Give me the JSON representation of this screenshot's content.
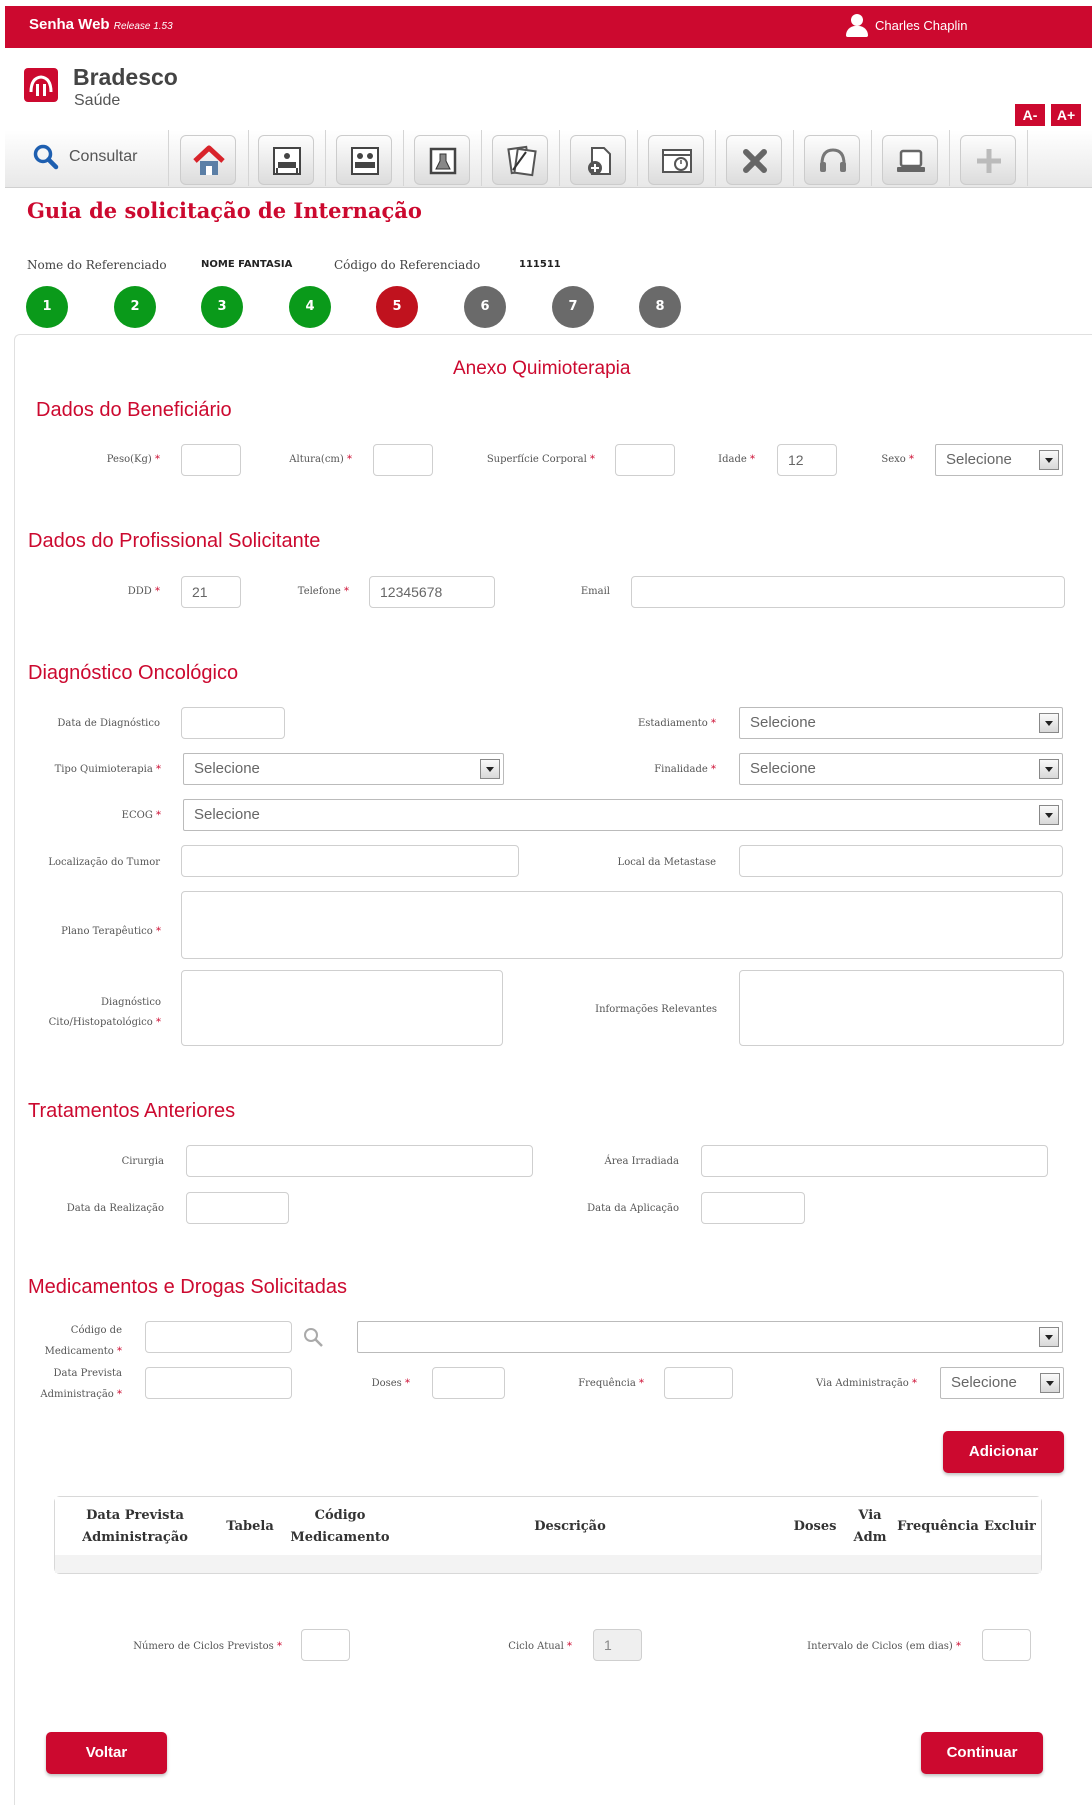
{
  "topbar": {
    "app_name": "Senha Web",
    "release": "Release 1.53",
    "user_name": "Charles Chaplin"
  },
  "logo": {
    "name": "Bradesco",
    "sub": "Saúde"
  },
  "font_controls": {
    "decrease": "A-",
    "increase": "A+"
  },
  "toolbar": {
    "search_label": "Consultar",
    "icons": [
      "home-icon",
      "bed-icon",
      "double-bed-icon",
      "lab-icon",
      "documents-icon",
      "add-file-icon",
      "schedule-icon",
      "close-icon",
      "headset-icon",
      "laptop-icon",
      "plus-icon"
    ]
  },
  "page_title": "Guia de solicitação de Internação",
  "referenced": {
    "name_label": "Nome do Referenciado",
    "name_value": "NOME FANTASIA",
    "code_label": "Código do Referenciado",
    "code_value": "111511"
  },
  "steps": [
    {
      "label": "1",
      "status": "done"
    },
    {
      "label": "2",
      "status": "done"
    },
    {
      "label": "3",
      "status": "done"
    },
    {
      "label": "4",
      "status": "done"
    },
    {
      "label": "5",
      "status": "current"
    },
    {
      "label": "6",
      "status": "pending"
    },
    {
      "label": "7",
      "status": "pending"
    },
    {
      "label": "8",
      "status": "pending"
    }
  ],
  "colors": {
    "brand": "#cc092f",
    "step_done": "#0a9a1a",
    "step_current": "#c0121e",
    "step_pending": "#6a6a6a"
  },
  "annex_title": "Anexo Quimioterapia",
  "beneficiario": {
    "title": "Dados do Beneficiário",
    "peso_label": "Peso(Kg)",
    "peso_value": "",
    "altura_label": "Altura(cm)",
    "altura_value": "",
    "superficie_label": "Superfície Corporal",
    "superficie_value": "",
    "idade_label": "Idade",
    "idade_value": "12",
    "sexo_label": "Sexo",
    "sexo_value": "Selecione"
  },
  "profissional": {
    "title": "Dados do Profissional Solicitante",
    "ddd_label": "DDD",
    "ddd_value": "21",
    "telefone_label": "Telefone",
    "telefone_value": "12345678",
    "email_label": "Email",
    "email_value": ""
  },
  "diagnostico": {
    "title": "Diagnóstico Oncológico",
    "data_label": "Data de Diagnóstico",
    "estadiamento_label": "Estadiamento",
    "estadiamento_value": "Selecione",
    "tipo_label": "Tipo Quimioterapia",
    "tipo_value": "Selecione",
    "finalidade_label": "Finalidade",
    "finalidade_value": "Selecione",
    "ecog_label": "ECOG",
    "ecog_value": "Selecione",
    "localizacao_label": "Localização do Tumor",
    "metastase_label": "Local da Metastase",
    "plano_label": "Plano Terapêutico",
    "cito_label_1": "Diagnóstico",
    "cito_label_2": "Cito/Histopatológico",
    "info_label": "Informações Relevantes"
  },
  "tratamentos": {
    "title": "Tratamentos Anteriores",
    "cirurgia_label": "Cirurgia",
    "area_label": "Área Irradiada",
    "data_realizacao_label": "Data da Realização",
    "data_aplicacao_label": "Data da Aplicação"
  },
  "medicamentos": {
    "title": "Medicamentos e Drogas Solicitadas",
    "codigo_label_1": "Código de",
    "codigo_label_2": "Medicamento",
    "data_prevista_label_1": "Data Prevista",
    "data_prevista_label_2": "Administração",
    "doses_label": "Doses",
    "frequencia_label": "Frequência",
    "via_label": "Via Administração",
    "via_value": "Selecione",
    "add_button": "Adicionar",
    "table_headers": [
      [
        "Data Prevista",
        "Administração"
      ],
      [
        "Tabela"
      ],
      [
        "Código",
        "Medicamento"
      ],
      [
        "Descrição"
      ],
      [
        "Doses"
      ],
      [
        "Via",
        "Adm"
      ],
      [
        "Frequência"
      ],
      [
        "Excluir"
      ]
    ]
  },
  "ciclos": {
    "previstos_label": "Número de Ciclos Previstos",
    "atual_label": "Ciclo Atual",
    "atual_value": "1",
    "intervalo_label": "Intervalo de Ciclos (em dias)"
  },
  "footer": {
    "back_button": "Voltar",
    "continue_button": "Continuar"
  }
}
